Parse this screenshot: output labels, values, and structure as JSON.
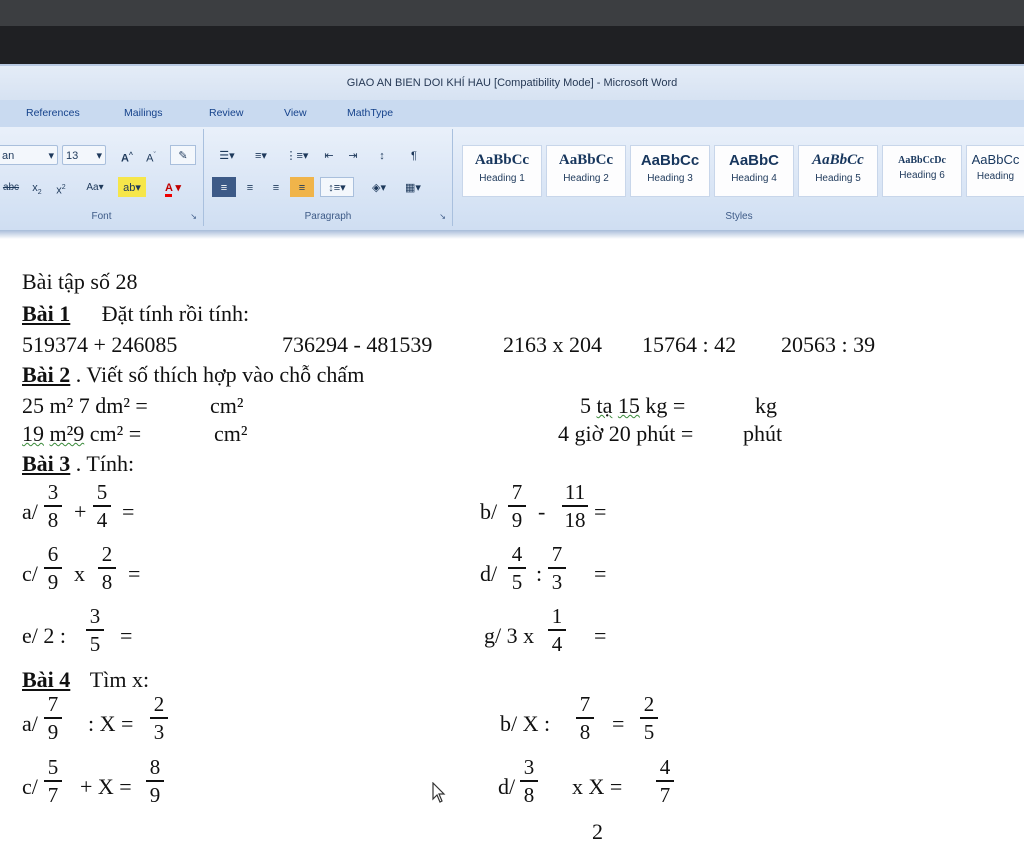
{
  "window": {
    "title": "GIAO AN BIEN DOI KHÍ HAU [Compatibility Mode] - Microsoft Word"
  },
  "tabs": [
    "References",
    "Mailings",
    "Review",
    "View",
    "MathType"
  ],
  "ribbon": {
    "font_name": "an",
    "font_size": "13",
    "font_group": "Font",
    "paragraph_group": "Paragraph",
    "styles_group": "Styles",
    "styles": [
      {
        "sample": "AaBbCc",
        "label": "Heading 1"
      },
      {
        "sample": "AaBbCc",
        "label": "Heading 2"
      },
      {
        "sample": "AaBbCc",
        "label": "Heading 3"
      },
      {
        "sample": "AaBbC",
        "label": "Heading 4"
      },
      {
        "sample": "AaBbCc",
        "label": "Heading 5"
      },
      {
        "sample": "AaBbCcDc",
        "label": "Heading 6"
      },
      {
        "sample": "AaBbCc",
        "label": "Heading"
      }
    ]
  },
  "doc": {
    "title": "Bài tập số 28",
    "b1": {
      "label": "Bài 1",
      "text": "Đặt tính rồi tính:",
      "items": [
        "519374 + 246085",
        "736294  - 481539",
        "2163 x 204",
        "15764 : 42",
        "20563 : 39"
      ]
    },
    "b2": {
      "label": "Bài 2",
      "text": ". Viết số thích hợp vào chỗ chấm",
      "r1a": "25 m² 7 dm² =",
      "r1a_u": "cm²",
      "r1b_pre": "5",
      "r1b_ta": "tạ",
      "r1b_15": "15",
      "r1b_kg": "kg =",
      "r1b_u": "kg",
      "r2a_pre": "19",
      "r2a_m": "m²9",
      "r2a_rest": "cm²  =",
      "r2a_u": "cm²",
      "r2b": "4 giờ 20 phút =",
      "r2b_u": "phút"
    },
    "b3": {
      "label": "Bài 3",
      "text": ". Tính:",
      "a": {
        "p": "a/",
        "f1": [
          "3",
          "8"
        ],
        "op": "+",
        "f2": [
          "5",
          "4"
        ],
        "eq": "="
      },
      "b": {
        "p": "b/",
        "f1": [
          "7",
          "9"
        ],
        "op": "-",
        "f2": [
          "11",
          "18"
        ],
        "eq": "="
      },
      "c": {
        "p": "c/",
        "f1": [
          "6",
          "9"
        ],
        "op": "x",
        "f2": [
          "2",
          "8"
        ],
        "eq": "="
      },
      "d": {
        "p": "d/",
        "f1": [
          "4",
          "5"
        ],
        "op": ":",
        "f2": [
          "7",
          "3"
        ],
        "eq": "="
      },
      "e": {
        "p": "e/ 2 :",
        "f1": [
          "3",
          "5"
        ],
        "eq": "="
      },
      "g": {
        "p": "g/ 3 x",
        "f1": [
          "1",
          "4"
        ],
        "eq": "="
      }
    },
    "b4": {
      "label": "Bài 4",
      "text": "Tìm x:",
      "a": {
        "p": "a/",
        "f1": [
          "7",
          "9"
        ],
        "mid": ": X =",
        "f2": [
          "2",
          "3"
        ]
      },
      "b": {
        "p": "b/ X :",
        "f1": [
          "7",
          "8"
        ],
        "mid": "=",
        "f2": [
          "2",
          "5"
        ]
      },
      "c": {
        "p": "c/",
        "f1": [
          "5",
          "7"
        ],
        "mid": "+ X =",
        "f2": [
          "8",
          "9"
        ]
      },
      "d": {
        "p": "d/",
        "f1": [
          "3",
          "8"
        ],
        "mid": "x   X =",
        "f2": [
          "4",
          "7"
        ]
      }
    },
    "bottom_digit": "2"
  }
}
